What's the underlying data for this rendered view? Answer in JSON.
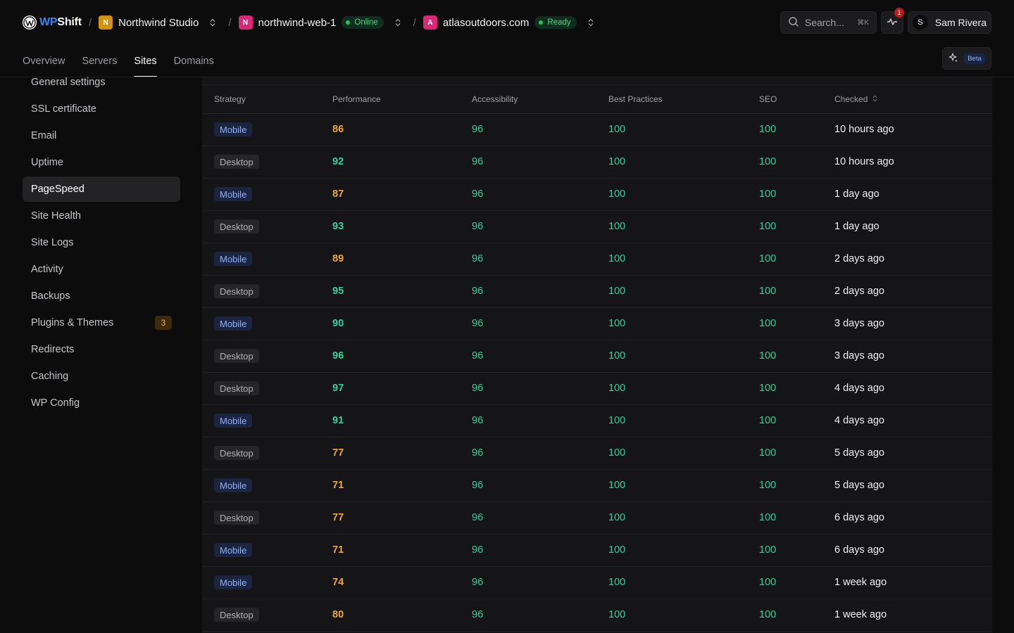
{
  "brand": {
    "wp": "WP",
    "shift": "Shift"
  },
  "breadcrumb": {
    "org": {
      "initial": "N",
      "label": "Northwind Studio",
      "color": "#d4930d"
    },
    "server": {
      "initial": "N",
      "label": "northwind-web-1",
      "status": "Online",
      "color": "#db2777"
    },
    "site": {
      "initial": "A",
      "label": "atlasoutdoors.com",
      "status": "Ready",
      "color": "#db2777"
    }
  },
  "search": {
    "placeholder": "Search...",
    "shortcut": "⌘K"
  },
  "notifications": {
    "count": "1"
  },
  "user": {
    "initial": "S",
    "name": "Sam Rivera"
  },
  "nav": {
    "tabs": [
      "Overview",
      "Servers",
      "Sites",
      "Domains"
    ],
    "active": "Sites"
  },
  "ai": {
    "badge": "Beta"
  },
  "sidebar": {
    "items": [
      {
        "label": "General settings"
      },
      {
        "label": "SSL certificate"
      },
      {
        "label": "Email"
      },
      {
        "label": "Uptime"
      },
      {
        "label": "PageSpeed",
        "active": true
      },
      {
        "label": "Site Health"
      },
      {
        "label": "Site Logs"
      },
      {
        "label": "Activity"
      },
      {
        "label": "Backups"
      },
      {
        "label": "Plugins & Themes",
        "count": "3"
      },
      {
        "label": "Redirects"
      },
      {
        "label": "Caching"
      },
      {
        "label": "WP Config"
      }
    ]
  },
  "table": {
    "headers": {
      "strategy": "Strategy",
      "performance": "Performance",
      "accessibility": "Accessibility",
      "best_practices": "Best Practices",
      "seo": "SEO",
      "checked": "Checked"
    },
    "rows": [
      {
        "strategy": "Mobile",
        "performance": "86",
        "accessibility": "96",
        "best_practices": "100",
        "seo": "100",
        "checked": "10 hours ago"
      },
      {
        "strategy": "Desktop",
        "performance": "92",
        "accessibility": "96",
        "best_practices": "100",
        "seo": "100",
        "checked": "10 hours ago"
      },
      {
        "strategy": "Mobile",
        "performance": "87",
        "accessibility": "96",
        "best_practices": "100",
        "seo": "100",
        "checked": "1 day ago"
      },
      {
        "strategy": "Desktop",
        "performance": "93",
        "accessibility": "96",
        "best_practices": "100",
        "seo": "100",
        "checked": "1 day ago"
      },
      {
        "strategy": "Mobile",
        "performance": "89",
        "accessibility": "96",
        "best_practices": "100",
        "seo": "100",
        "checked": "2 days ago"
      },
      {
        "strategy": "Desktop",
        "performance": "95",
        "accessibility": "96",
        "best_practices": "100",
        "seo": "100",
        "checked": "2 days ago"
      },
      {
        "strategy": "Mobile",
        "performance": "90",
        "accessibility": "96",
        "best_practices": "100",
        "seo": "100",
        "checked": "3 days ago"
      },
      {
        "strategy": "Desktop",
        "performance": "96",
        "accessibility": "96",
        "best_practices": "100",
        "seo": "100",
        "checked": "3 days ago"
      },
      {
        "strategy": "Desktop",
        "performance": "97",
        "accessibility": "96",
        "best_practices": "100",
        "seo": "100",
        "checked": "4 days ago"
      },
      {
        "strategy": "Mobile",
        "performance": "91",
        "accessibility": "96",
        "best_practices": "100",
        "seo": "100",
        "checked": "4 days ago"
      },
      {
        "strategy": "Desktop",
        "performance": "77",
        "accessibility": "96",
        "best_practices": "100",
        "seo": "100",
        "checked": "5 days ago"
      },
      {
        "strategy": "Mobile",
        "performance": "71",
        "accessibility": "96",
        "best_practices": "100",
        "seo": "100",
        "checked": "5 days ago"
      },
      {
        "strategy": "Desktop",
        "performance": "77",
        "accessibility": "96",
        "best_practices": "100",
        "seo": "100",
        "checked": "6 days ago"
      },
      {
        "strategy": "Mobile",
        "performance": "71",
        "accessibility": "96",
        "best_practices": "100",
        "seo": "100",
        "checked": "6 days ago"
      },
      {
        "strategy": "Mobile",
        "performance": "74",
        "accessibility": "96",
        "best_practices": "100",
        "seo": "100",
        "checked": "1 week ago"
      },
      {
        "strategy": "Desktop",
        "performance": "80",
        "accessibility": "96",
        "best_practices": "100",
        "seo": "100",
        "checked": "1 week ago"
      }
    ]
  },
  "colors": {
    "score_good": "#34d399",
    "score_average": "#f0a63a",
    "accent": "#3b82f6"
  }
}
